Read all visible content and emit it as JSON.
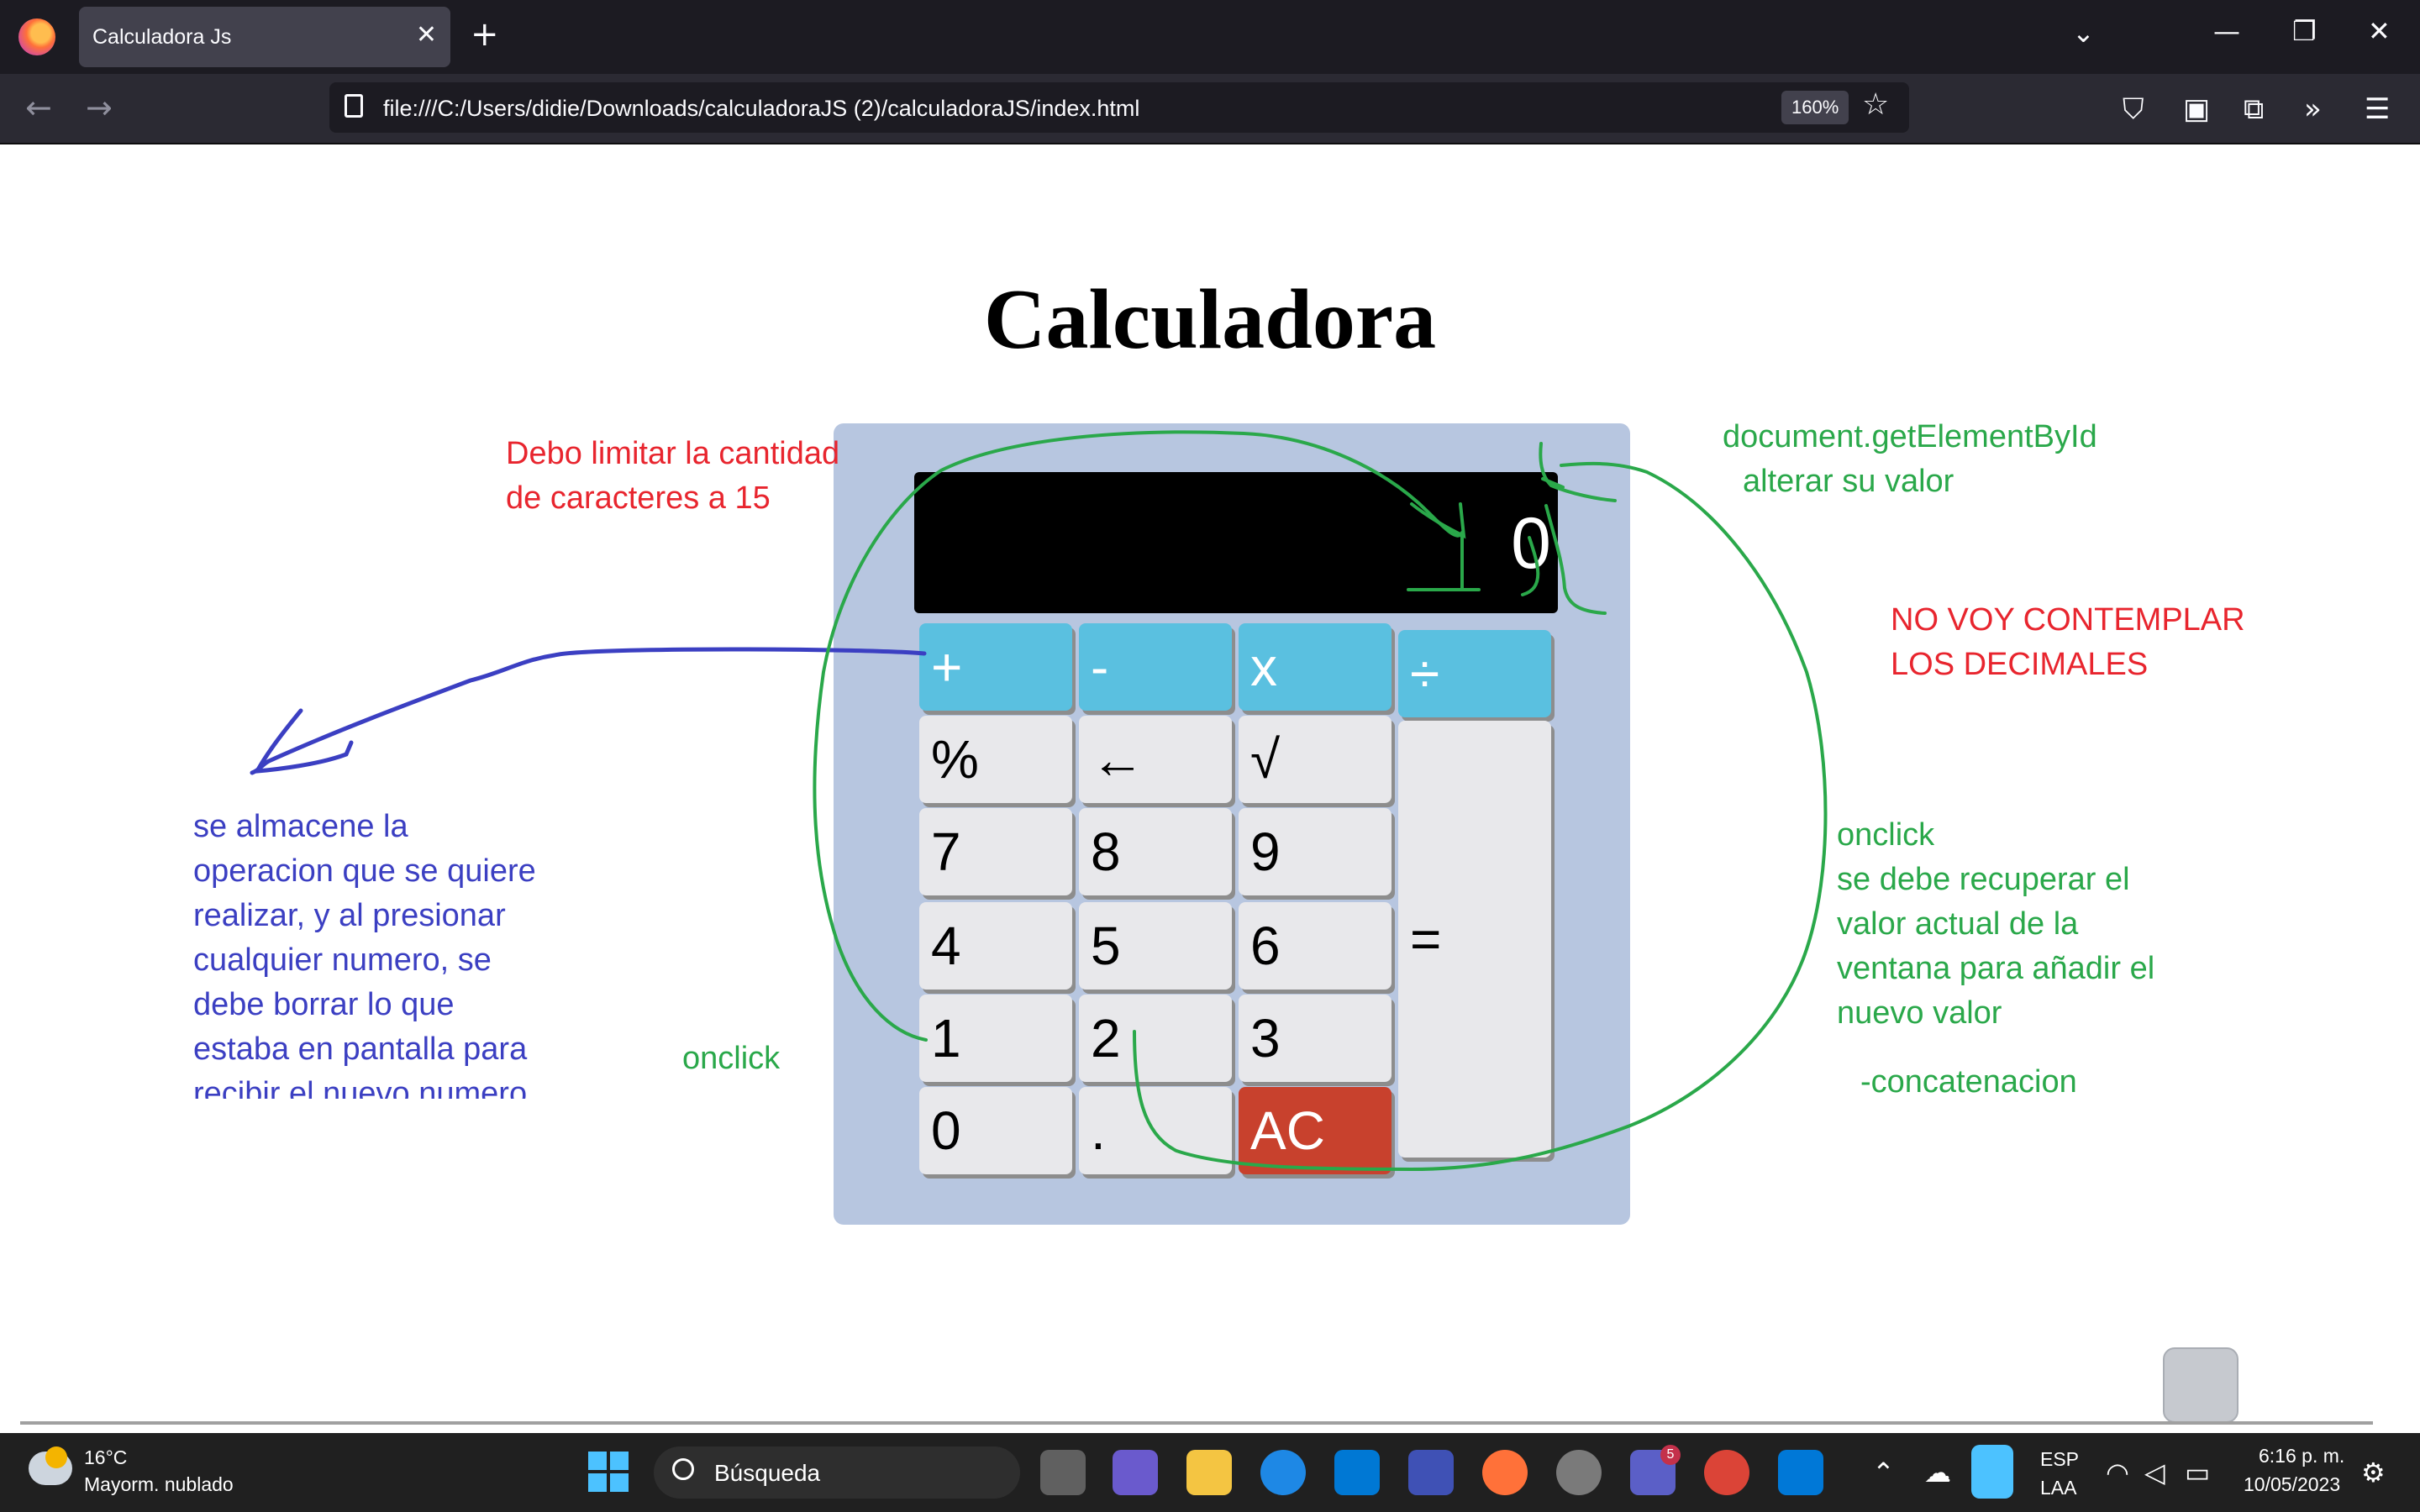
{
  "browser": {
    "tab_title": "Calculadora Js",
    "url": "file:///C:/Users/didie/Downloads/calculadoraJS (2)/calculadoraJS/index.html",
    "zoom": "160%"
  },
  "page": {
    "title": "Calculadora",
    "display_value": "0",
    "keys": {
      "plus": "+",
      "minus": "-",
      "times": "x",
      "divide": "÷",
      "percent": "%",
      "backspace": "←",
      "sqrt": "√",
      "seven": "7",
      "eight": "8",
      "nine": "9",
      "four": "4",
      "five": "5",
      "six": "6",
      "one": "1",
      "two": "2",
      "three": "3",
      "zero": "0",
      "dot": ".",
      "clear": "AC",
      "equals": "="
    }
  },
  "annotations": {
    "limit_line1": "Debo limitar la cantidad",
    "limit_line2": "de caracteres a 15",
    "getelement_line1": "document.getElementById",
    "getelement_line2": "alterar su valor",
    "no_decimals_line1": "NO VOY  CONTEMPLAR",
    "no_decimals_line2": "LOS DECIMALES",
    "onclick_right_1": "onclick",
    "onclick_right_2": "se debe recuperar el",
    "onclick_right_3": "valor actual de la",
    "onclick_right_4": "ventana para añadir el",
    "onclick_right_5": "nuevo valor",
    "concat": "-concatenacion",
    "onclick_left": "onclick",
    "store_1": "se almacene la",
    "store_2": "operacion que se quiere",
    "store_3": "realizar, y al presionar",
    "store_4": "cualquier numero, se",
    "store_5": "debe borrar lo que",
    "store_6": "estaba en pantalla para",
    "store_7": "recibir el nuevo numero"
  },
  "taskbar": {
    "temperature": "16°C",
    "weather": "Mayorm. nublado",
    "search_placeholder": "Búsqueda",
    "language_1": "ESP",
    "language_2": "LAA",
    "time": "6:16 p. m.",
    "date": "10/05/2023",
    "teams_badge": "5"
  },
  "colors": {
    "operator_key": "#5ac0e0",
    "clear_key": "#c8412d",
    "calculator_body": "#b7c6e0",
    "annotation_red": "#e8252e",
    "annotation_green": "#2aa84a",
    "annotation_blue": "#3b3fc2"
  }
}
